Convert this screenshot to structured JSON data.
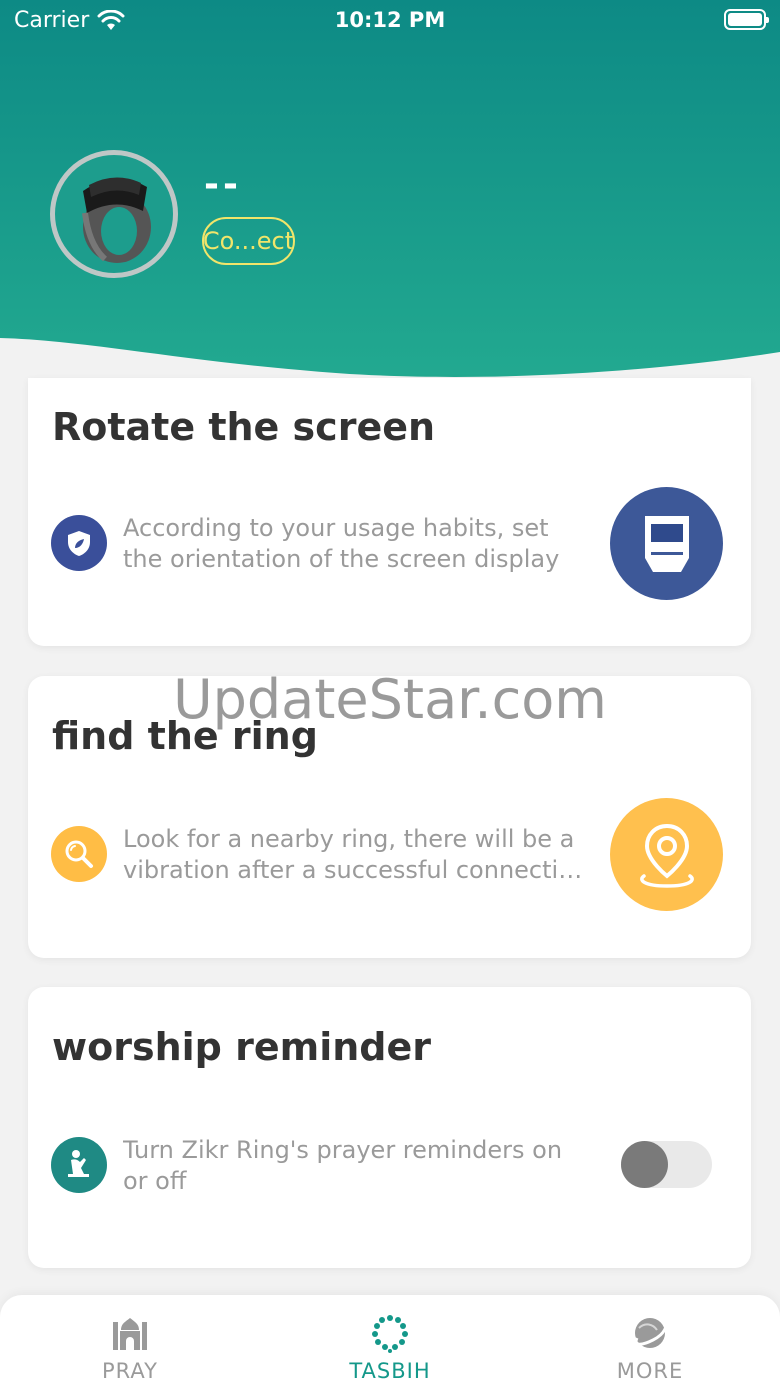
{
  "status_bar": {
    "carrier": "Carrier",
    "time": "10:12 PM"
  },
  "header": {
    "device_name": "--",
    "connect_label": "Co...ect",
    "gradient_colors": [
      "#0d8a85",
      "#22a990"
    ],
    "connect_color": "#f1e56a"
  },
  "cards": [
    {
      "title": "Rotate the screen",
      "icon": "shield-icon",
      "icon_color": "#3a4f9a",
      "description_lines": [
        "According to your usage habits, set",
        "the orientation of the screen display"
      ],
      "action_icon": "screen-rotate-icon",
      "action_color": "#3d5898"
    },
    {
      "title": "find the ring",
      "icon": "search-icon",
      "icon_color": "#ffbd45",
      "description_lines": [
        "Look for a nearby ring, there will be a",
        "vibration after a successful connection"
      ],
      "action_icon": "location-pin-icon",
      "action_color": "#ffc04e"
    },
    {
      "title": "worship reminder",
      "icon": "praying-person-icon",
      "icon_color": "#1f8a84",
      "description_lines": [
        "Turn Zikr Ring's prayer reminders on",
        "or off"
      ],
      "toggle_on": false
    }
  ],
  "watermark": "UpdateStar.com",
  "tabs": [
    {
      "label": "PRAY",
      "icon": "mosque-icon",
      "active": false
    },
    {
      "label": "TASBIH",
      "icon": "tasbih-beads-icon",
      "active": true
    },
    {
      "label": "MORE",
      "icon": "planet-icon",
      "active": false
    }
  ],
  "colors": {
    "accent": "#14988a",
    "inactive": "#9a9a9a"
  }
}
